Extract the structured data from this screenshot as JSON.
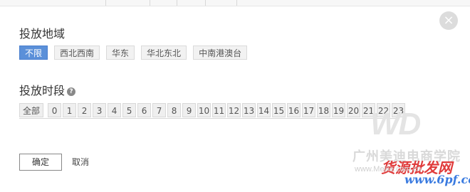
{
  "dialog": {
    "close_icon": "×"
  },
  "region": {
    "title": "投放地域",
    "options": [
      {
        "label": "不限",
        "selected": true
      },
      {
        "label": "西北西南",
        "selected": false
      },
      {
        "label": "华东",
        "selected": false
      },
      {
        "label": "华北东北",
        "selected": false
      },
      {
        "label": "中南港澳台",
        "selected": false
      }
    ]
  },
  "schedule": {
    "title": "投放时段",
    "help_icon": "?",
    "all_label": "全部",
    "hours": [
      "0",
      "1",
      "2",
      "3",
      "4",
      "5",
      "6",
      "7",
      "8",
      "9",
      "10",
      "11",
      "12",
      "13",
      "14",
      "15",
      "16",
      "17",
      "18",
      "19",
      "20",
      "21",
      "22",
      "23"
    ]
  },
  "footer": {
    "ok_label": "确定",
    "cancel_label": "取消"
  },
  "watermark": {
    "logo": "WD",
    "line1": "广州美迪电商学院",
    "line2": "货源批发网",
    "url1": "www.Meilie.com.cn",
    "url2": "www.6pf.com"
  },
  "colors": {
    "selected_chip": "#5b90d9",
    "chip_bg": "#f2f2f2"
  }
}
